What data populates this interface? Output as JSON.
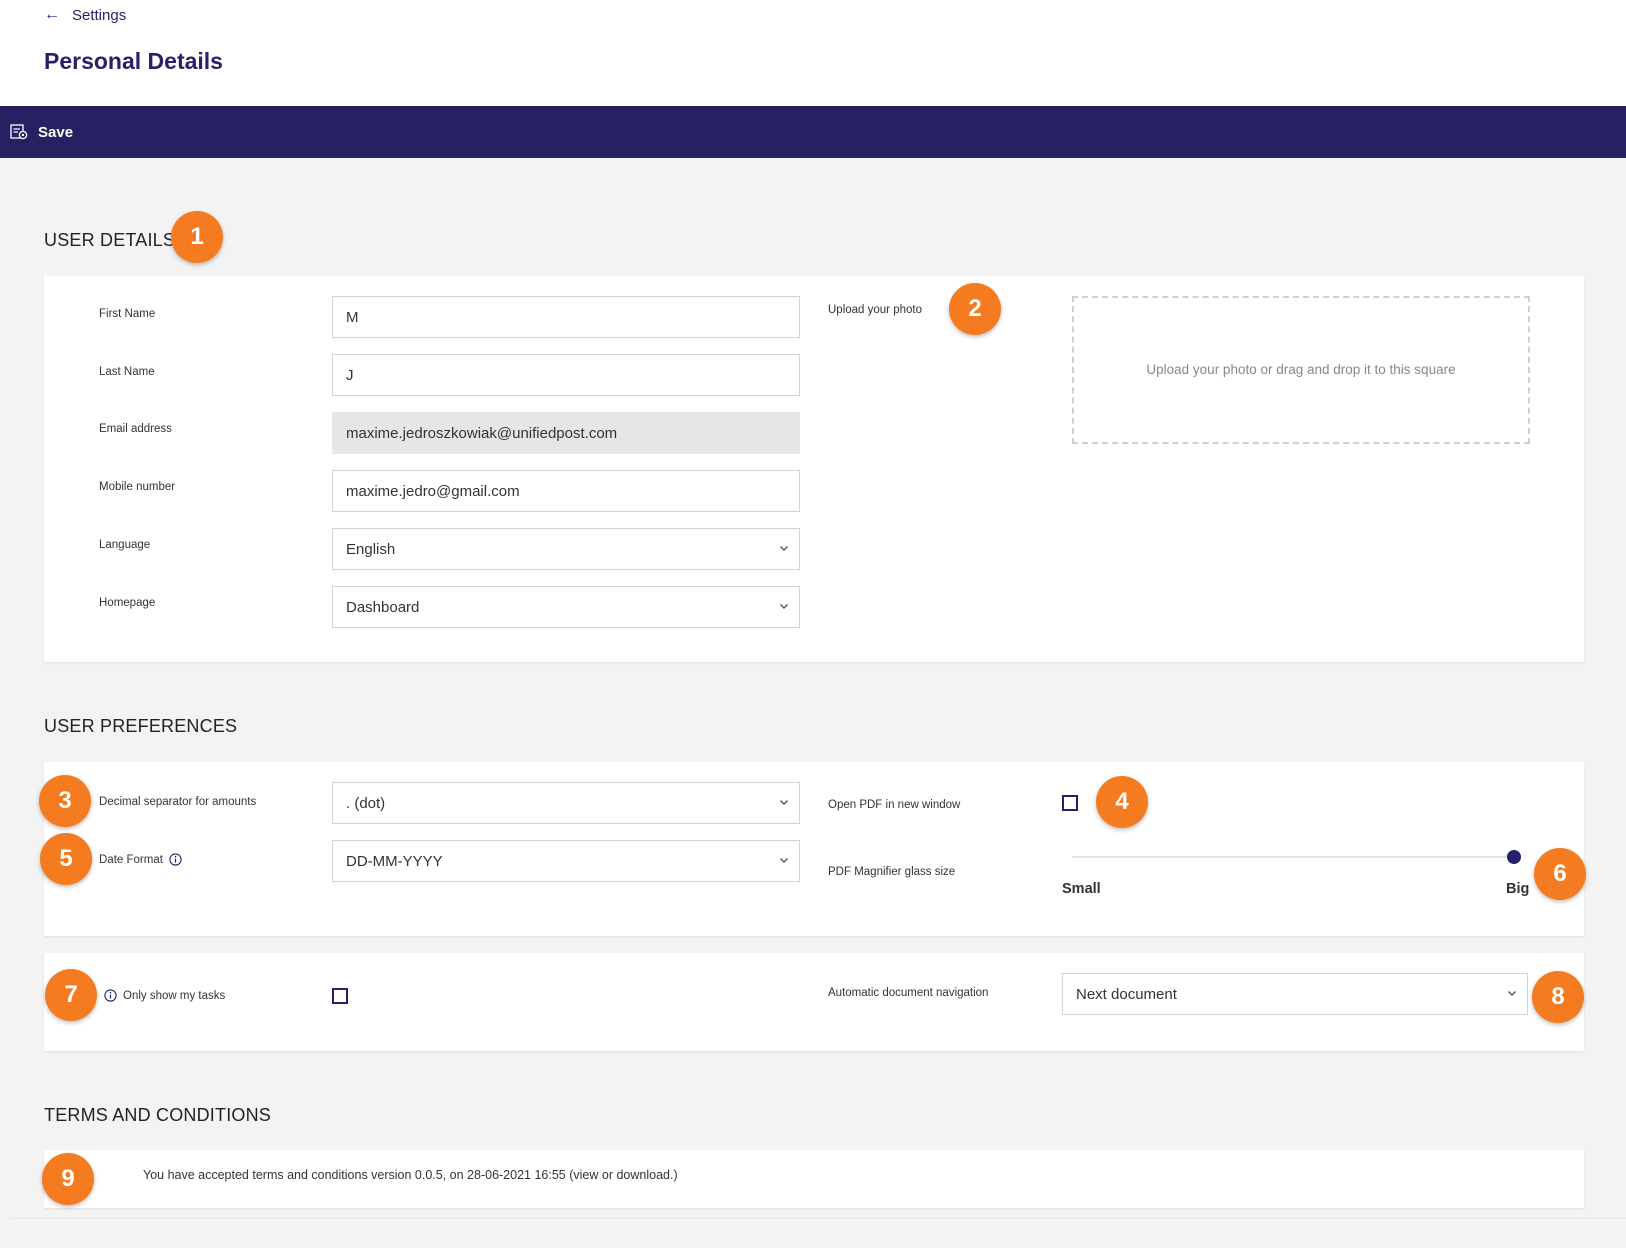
{
  "header": {
    "back_label": "Settings",
    "title": "Personal Details"
  },
  "toolbar": {
    "save_label": "Save",
    "save_icon": "save-document-icon"
  },
  "user_details": {
    "section_title": "USER DETAILS",
    "first_name": {
      "label": "First Name",
      "value": "M"
    },
    "last_name": {
      "label": "Last Name",
      "value": "J"
    },
    "email": {
      "label": "Email address",
      "value": "maxime.jedroszkowiak@unifiedpost.com"
    },
    "mobile": {
      "label": "Mobile number",
      "value": "maxime.jedro@gmail.com"
    },
    "language": {
      "label": "Language",
      "value": "English"
    },
    "homepage": {
      "label": "Homepage",
      "value": "Dashboard"
    },
    "photo": {
      "label": "Upload your photo",
      "dropzone_text": "Upload your photo or drag and drop it to this square"
    }
  },
  "user_preferences": {
    "section_title": "USER PREFERENCES",
    "decimal_separator": {
      "label": "Decimal separator for amounts",
      "value": ". (dot)"
    },
    "date_format": {
      "label": "Date Format",
      "value": "DD-MM-YYYY"
    },
    "open_pdf": {
      "label": "Open PDF in new window",
      "checked": false
    },
    "magnifier": {
      "label": "PDF Magnifier glass size",
      "min_label": "Small",
      "max_label": "Big",
      "level": 1.0
    },
    "only_my_tasks": {
      "label": "Only show my tasks",
      "checked": false
    },
    "auto_navigation": {
      "label": "Automatic document navigation",
      "value": "Next document"
    }
  },
  "terms": {
    "section_title": "TERMS AND CONDITIONS",
    "text_prefix": "You have accepted terms and conditions version 0.0.5, on 28-06-2021 16:55 (",
    "link_view": "view",
    "text_or": " or ",
    "link_download": "download.",
    "text_suffix": ")"
  },
  "callouts": [
    "1",
    "2",
    "3",
    "4",
    "5",
    "6",
    "7",
    "8",
    "9"
  ],
  "colors": {
    "brand_navy": "#252163",
    "accent_orange": "#f47b20",
    "page_background": "#f3f3f3"
  }
}
